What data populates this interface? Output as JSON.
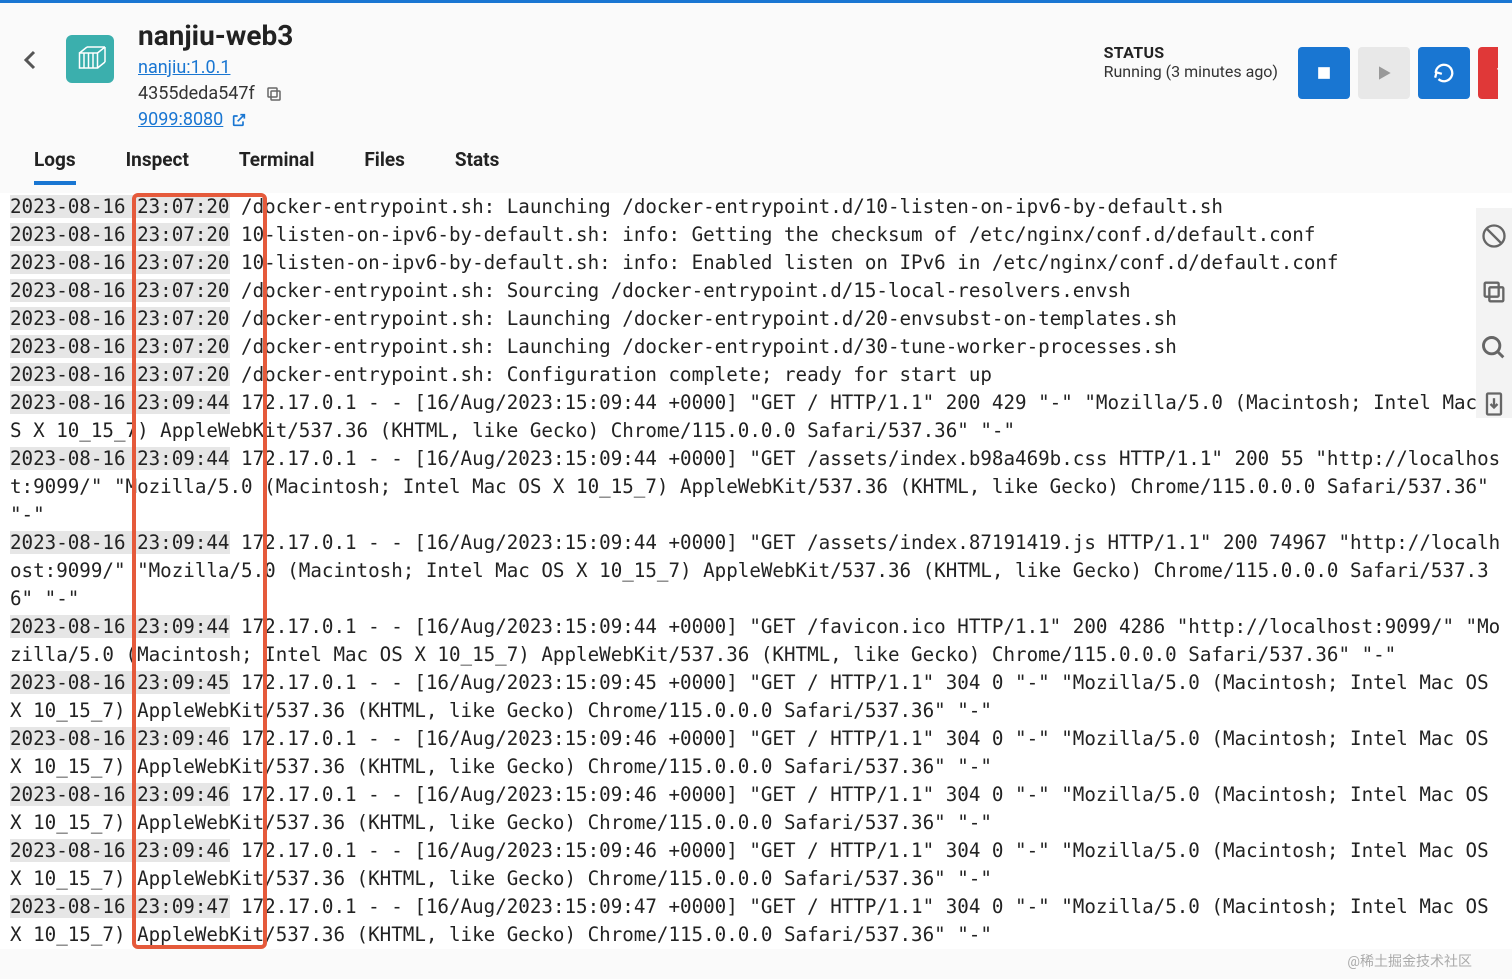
{
  "header": {
    "title": "nanjiu-web3",
    "image_link": "nanjiu:1.0.1",
    "container_id": "4355deda547f",
    "ports_link": "9099:8080"
  },
  "status": {
    "label": "STATUS",
    "value": "Running (3 minutes ago)"
  },
  "tabs": [
    {
      "key": "logs",
      "label": "Logs",
      "active": true
    },
    {
      "key": "inspect",
      "label": "Inspect",
      "active": false
    },
    {
      "key": "terminal",
      "label": "Terminal",
      "active": false
    },
    {
      "key": "files",
      "label": "Files",
      "active": false
    },
    {
      "key": "stats",
      "label": "Stats",
      "active": false
    }
  ],
  "logs": [
    {
      "ts": "2023-08-16 23:07:20",
      "msg": " /docker-entrypoint.sh: Launching /docker-entrypoint.d/10-listen-on-ipv6-by-default.sh"
    },
    {
      "ts": "2023-08-16 23:07:20",
      "msg": " 10-listen-on-ipv6-by-default.sh: info: Getting the checksum of /etc/nginx/conf.d/default.conf"
    },
    {
      "ts": "2023-08-16 23:07:20",
      "msg": " 10-listen-on-ipv6-by-default.sh: info: Enabled listen on IPv6 in /etc/nginx/conf.d/default.conf"
    },
    {
      "ts": "2023-08-16 23:07:20",
      "msg": " /docker-entrypoint.sh: Sourcing /docker-entrypoint.d/15-local-resolvers.envsh"
    },
    {
      "ts": "2023-08-16 23:07:20",
      "msg": " /docker-entrypoint.sh: Launching /docker-entrypoint.d/20-envsubst-on-templates.sh"
    },
    {
      "ts": "2023-08-16 23:07:20",
      "msg": " /docker-entrypoint.sh: Launching /docker-entrypoint.d/30-tune-worker-processes.sh"
    },
    {
      "ts": "2023-08-16 23:07:20",
      "msg": " /docker-entrypoint.sh: Configuration complete; ready for start up"
    },
    {
      "ts": "2023-08-16 23:09:44",
      "msg": " 172.17.0.1 - - [16/Aug/2023:15:09:44 +0000] \"GET / HTTP/1.1\" 200 429 \"-\" \"Mozilla/5.0 (Macintosh; Intel Mac OS X 10_15_7) AppleWebKit/537.36 (KHTML, like Gecko) Chrome/115.0.0.0 Safari/537.36\" \"-\""
    },
    {
      "ts": "2023-08-16 23:09:44",
      "msg": " 172.17.0.1 - - [16/Aug/2023:15:09:44 +0000] \"GET /assets/index.b98a469b.css HTTP/1.1\" 200 55 \"http://localhost:9099/\" \"Mozilla/5.0 (Macintosh; Intel Mac OS X 10_15_7) AppleWebKit/537.36 (KHTML, like Gecko) Chrome/115.0.0.0 Safari/537.36\" \"-\""
    },
    {
      "ts": "2023-08-16 23:09:44",
      "msg": " 172.17.0.1 - - [16/Aug/2023:15:09:44 +0000] \"GET /assets/index.87191419.js HTTP/1.1\" 200 74967 \"http://localhost:9099/\" \"Mozilla/5.0 (Macintosh; Intel Mac OS X 10_15_7) AppleWebKit/537.36 (KHTML, like Gecko) Chrome/115.0.0.0 Safari/537.36\" \"-\""
    },
    {
      "ts": "2023-08-16 23:09:44",
      "msg": " 172.17.0.1 - - [16/Aug/2023:15:09:44 +0000] \"GET /favicon.ico HTTP/1.1\" 200 4286 \"http://localhost:9099/\" \"Mozilla/5.0 (Macintosh; Intel Mac OS X 10_15_7) AppleWebKit/537.36 (KHTML, like Gecko) Chrome/115.0.0.0 Safari/537.36\" \"-\""
    },
    {
      "ts": "2023-08-16 23:09:45",
      "msg": " 172.17.0.1 - - [16/Aug/2023:15:09:45 +0000] \"GET / HTTP/1.1\" 304 0 \"-\" \"Mozilla/5.0 (Macintosh; Intel Mac OS X 10_15_7) AppleWebKit/537.36 (KHTML, like Gecko) Chrome/115.0.0.0 Safari/537.36\" \"-\""
    },
    {
      "ts": "2023-08-16 23:09:46",
      "msg": " 172.17.0.1 - - [16/Aug/2023:15:09:46 +0000] \"GET / HTTP/1.1\" 304 0 \"-\" \"Mozilla/5.0 (Macintosh; Intel Mac OS X 10_15_7) AppleWebKit/537.36 (KHTML, like Gecko) Chrome/115.0.0.0 Safari/537.36\" \"-\""
    },
    {
      "ts": "2023-08-16 23:09:46",
      "msg": " 172.17.0.1 - - [16/Aug/2023:15:09:46 +0000] \"GET / HTTP/1.1\" 304 0 \"-\" \"Mozilla/5.0 (Macintosh; Intel Mac OS X 10_15_7) AppleWebKit/537.36 (KHTML, like Gecko) Chrome/115.0.0.0 Safari/537.36\" \"-\""
    },
    {
      "ts": "2023-08-16 23:09:46",
      "msg": " 172.17.0.1 - - [16/Aug/2023:15:09:46 +0000] \"GET / HTTP/1.1\" 304 0 \"-\" \"Mozilla/5.0 (Macintosh; Intel Mac OS X 10_15_7) AppleWebKit/537.36 (KHTML, like Gecko) Chrome/115.0.0.0 Safari/537.36\" \"-\""
    },
    {
      "ts": "2023-08-16 23:09:47",
      "msg": " 172.17.0.1 - - [16/Aug/2023:15:09:47 +0000] \"GET / HTTP/1.1\" 304 0 \"-\" \"Mozilla/5.0 (Macintosh; Intel Mac OS X 10_15_7) AppleWebKit/537.36 (KHTML, like Gecko) Chrome/115.0.0.0 Safari/537.36\" \"-\""
    }
  ],
  "watermark": "@稀土掘金技术社区"
}
